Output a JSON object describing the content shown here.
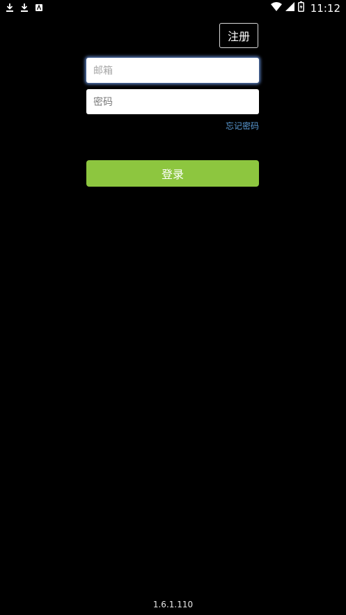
{
  "status_bar": {
    "left_icons": [
      "download-icon",
      "download-icon",
      "app-notification-icon"
    ],
    "right_icons": [
      "wifi-icon",
      "signal-icon",
      "battery-icon"
    ],
    "time": "11:12"
  },
  "header": {
    "register_label": "注册"
  },
  "form": {
    "email_placeholder": "邮箱",
    "password_placeholder": "密码",
    "forgot_label": "忘记密码",
    "login_label": "登录"
  },
  "footer": {
    "version": "1.6.1.110"
  },
  "colors": {
    "background": "#000000",
    "login_button": "#8dc63f",
    "link": "#5b9bd5",
    "focus_glow": "#78aaff"
  }
}
